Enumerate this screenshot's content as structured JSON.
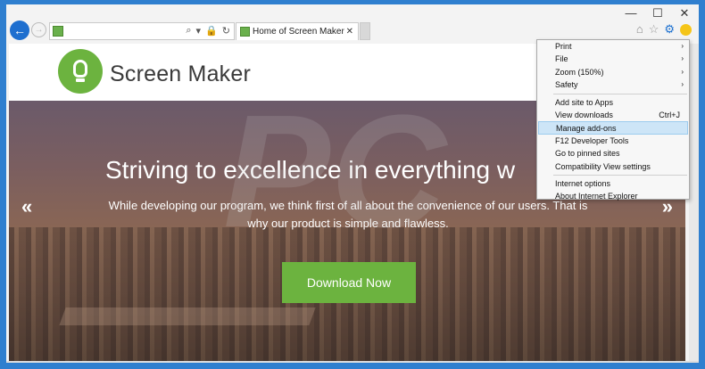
{
  "window": {
    "minimize": "—",
    "maximize": "☐",
    "close": "✕"
  },
  "toolbar": {
    "address_value": "",
    "address_icons": [
      "⌕",
      "▾",
      "🔒",
      "↻"
    ],
    "tab_title": "Home of Screen Maker",
    "tab_close": "✕",
    "back_glyph": "←",
    "forward_glyph": "→",
    "right_icons": {
      "home": "⌂",
      "favorites": "☆",
      "tools": "⚙"
    }
  },
  "site": {
    "logo_text": "Screen Maker",
    "watermark": "PC",
    "hero_title": "Striving to excellence in everything w",
    "hero_subtitle": "While developing our program, we think first of all about the convenience of our users. That is why our product is simple and flawless.",
    "arrow_left": "«",
    "arrow_right": "»",
    "download_label": "Download Now"
  },
  "menu": {
    "items": [
      {
        "label": "Print",
        "arrow": "›"
      },
      {
        "label": "File",
        "arrow": "›"
      },
      {
        "label": "Zoom (150%)",
        "arrow": "›"
      },
      {
        "label": "Safety",
        "arrow": "›"
      },
      {
        "label": "Add site to Apps"
      },
      {
        "label": "View downloads",
        "shortcut": "Ctrl+J"
      },
      {
        "label": "Manage add-ons"
      },
      {
        "label": "F12 Developer Tools"
      },
      {
        "label": "Go to pinned sites"
      },
      {
        "label": "Compatibility View settings"
      },
      {
        "label": "Internet options"
      },
      {
        "label": "About Internet Explorer"
      }
    ]
  },
  "colors": {
    "accent_green": "#6cb33f",
    "frame_blue": "#2f7fcf",
    "menu_highlight": "#cde5f7"
  }
}
